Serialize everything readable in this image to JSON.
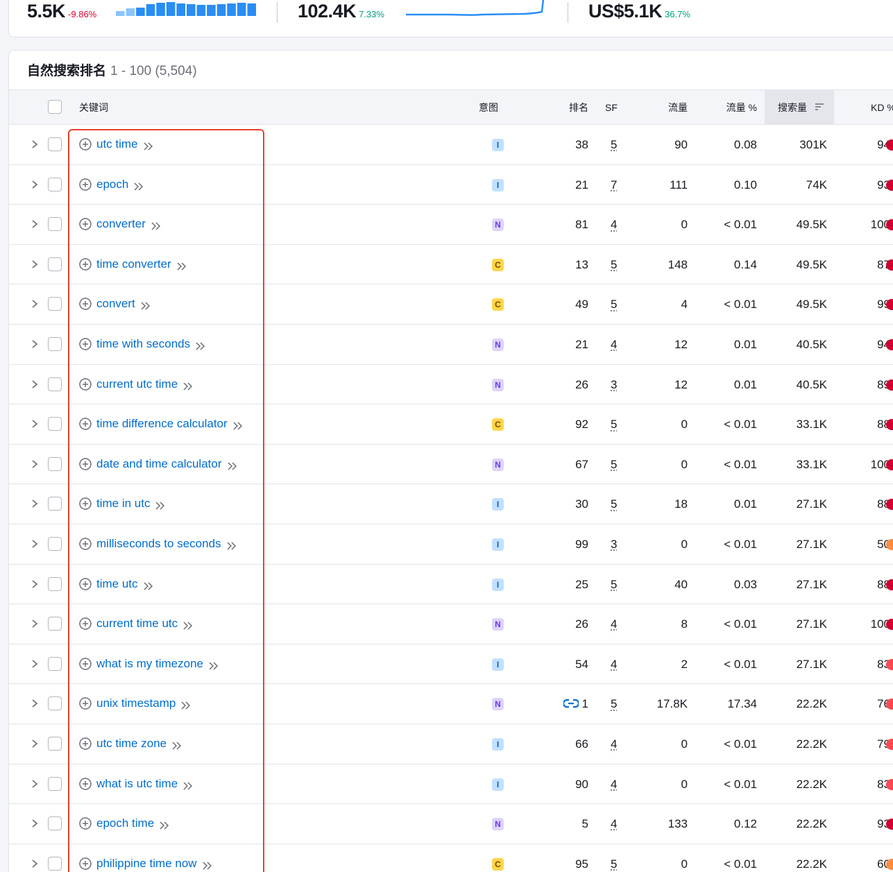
{
  "metrics": {
    "keywords": {
      "value": "5.5K",
      "change": "-9.86%",
      "trend_bars": [
        0.35,
        0.55,
        0.6,
        0.85,
        0.95,
        1.0,
        0.9,
        0.85,
        0.8,
        0.8,
        0.85,
        0.9,
        0.95,
        0.9
      ]
    },
    "traffic": {
      "value": "102.4K",
      "change": "7.33%"
    },
    "traffic_cost": {
      "value": "US$5.1K",
      "change": "36.7%"
    },
    "colors": {
      "negative": "#d1002f",
      "positive": "#009f81",
      "bar_dark": "#2a8df4",
      "bar_light": "#8cc4fb"
    }
  },
  "table": {
    "title": "自然搜索排名",
    "range": "1 - 100 (5,504)",
    "headers": {
      "keyword": "关键词",
      "intent": "意图",
      "position": "排名",
      "sf": "SF",
      "traffic": "流量",
      "traffic_pct": "流量 %",
      "volume": "搜索量",
      "kd": "KD %"
    },
    "sorted_column": "volume",
    "rows": [
      {
        "keyword": "utc time",
        "intent": "I",
        "position": "38",
        "sf": "5",
        "traffic": "90",
        "traffic_pct": "0.08",
        "volume": "301K",
        "kd": "94",
        "kd_color": "#d1002f"
      },
      {
        "keyword": "epoch",
        "intent": "I",
        "position": "21",
        "sf": "7",
        "traffic": "111",
        "traffic_pct": "0.10",
        "volume": "74K",
        "kd": "93",
        "kd_color": "#d1002f"
      },
      {
        "keyword": "converter",
        "intent": "N",
        "position": "81",
        "sf": "4",
        "traffic": "0",
        "traffic_pct": "< 0.01",
        "volume": "49.5K",
        "kd": "100",
        "kd_color": "#d1002f"
      },
      {
        "keyword": "time converter",
        "intent": "C",
        "position": "13",
        "sf": "5",
        "traffic": "148",
        "traffic_pct": "0.14",
        "volume": "49.5K",
        "kd": "87",
        "kd_color": "#d1002f"
      },
      {
        "keyword": "convert",
        "intent": "C",
        "position": "49",
        "sf": "5",
        "traffic": "4",
        "traffic_pct": "< 0.01",
        "volume": "49.5K",
        "kd": "99",
        "kd_color": "#d1002f"
      },
      {
        "keyword": "time with seconds",
        "intent": "N",
        "position": "21",
        "sf": "4",
        "traffic": "12",
        "traffic_pct": "0.01",
        "volume": "40.5K",
        "kd": "94",
        "kd_color": "#d1002f"
      },
      {
        "keyword": "current utc time",
        "intent": "N",
        "position": "26",
        "sf": "3",
        "traffic": "12",
        "traffic_pct": "0.01",
        "volume": "40.5K",
        "kd": "89",
        "kd_color": "#d1002f"
      },
      {
        "keyword": "time difference calculator",
        "intent": "C",
        "position": "92",
        "sf": "5",
        "traffic": "0",
        "traffic_pct": "< 0.01",
        "volume": "33.1K",
        "kd": "88",
        "kd_color": "#d1002f"
      },
      {
        "keyword": "date and time calculator",
        "intent": "N",
        "position": "67",
        "sf": "5",
        "traffic": "0",
        "traffic_pct": "< 0.01",
        "volume": "33.1K",
        "kd": "100",
        "kd_color": "#d1002f"
      },
      {
        "keyword": "time in utc",
        "intent": "I",
        "position": "30",
        "sf": "5",
        "traffic": "18",
        "traffic_pct": "0.01",
        "volume": "27.1K",
        "kd": "88",
        "kd_color": "#d1002f"
      },
      {
        "keyword": "milliseconds to seconds",
        "intent": "I",
        "position": "99",
        "sf": "3",
        "traffic": "0",
        "traffic_pct": "< 0.01",
        "volume": "27.1K",
        "kd": "50",
        "kd_color": "#ff8c43"
      },
      {
        "keyword": "time utc",
        "intent": "I",
        "position": "25",
        "sf": "5",
        "traffic": "40",
        "traffic_pct": "0.03",
        "volume": "27.1K",
        "kd": "88",
        "kd_color": "#d1002f"
      },
      {
        "keyword": "current time utc",
        "intent": "N",
        "position": "26",
        "sf": "4",
        "traffic": "8",
        "traffic_pct": "< 0.01",
        "volume": "27.1K",
        "kd": "100",
        "kd_color": "#d1002f"
      },
      {
        "keyword": "what is my timezone",
        "intent": "I",
        "position": "54",
        "sf": "4",
        "traffic": "2",
        "traffic_pct": "< 0.01",
        "volume": "27.1K",
        "kd": "83",
        "kd_color": "#ff4953"
      },
      {
        "keyword": "unix timestamp",
        "intent": "N",
        "position": "1",
        "sf": "5",
        "traffic": "17.8K",
        "traffic_pct": "17.34",
        "volume": "22.2K",
        "kd": "76",
        "kd_color": "#ff4953",
        "linked": true
      },
      {
        "keyword": "utc time zone",
        "intent": "I",
        "position": "66",
        "sf": "4",
        "traffic": "0",
        "traffic_pct": "< 0.01",
        "volume": "22.2K",
        "kd": "79",
        "kd_color": "#ff4953"
      },
      {
        "keyword": "what is utc time",
        "intent": "I",
        "position": "90",
        "sf": "4",
        "traffic": "0",
        "traffic_pct": "< 0.01",
        "volume": "22.2K",
        "kd": "83",
        "kd_color": "#ff4953"
      },
      {
        "keyword": "epoch time",
        "intent": "N",
        "position": "5",
        "sf": "4",
        "traffic": "133",
        "traffic_pct": "0.12",
        "volume": "22.2K",
        "kd": "93",
        "kd_color": "#d1002f"
      },
      {
        "keyword": "philippine time now",
        "intent": "C",
        "position": "95",
        "sf": "5",
        "traffic": "0",
        "traffic_pct": "< 0.01",
        "volume": "22.2K",
        "kd": "60",
        "kd_color": "#ff8c43"
      }
    ]
  }
}
